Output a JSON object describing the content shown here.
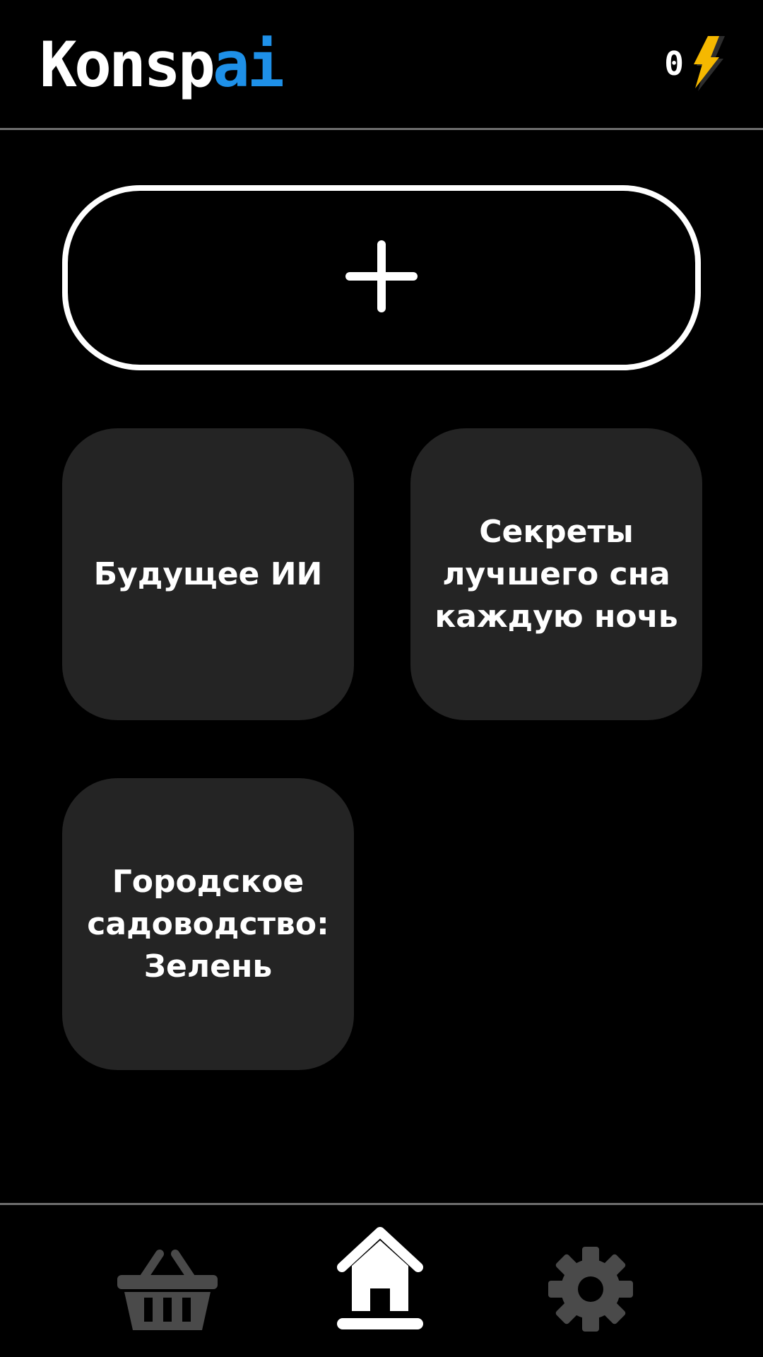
{
  "header": {
    "logo_main": "Konsp",
    "logo_accent": "ai",
    "energy_count": "0",
    "energy_icon": "lightning-icon"
  },
  "create": {
    "icon": "plus-icon"
  },
  "cards": [
    {
      "label": "Будущее ИИ"
    },
    {
      "label": "Секреты\nлучшего сна\nкаждую ночь"
    },
    {
      "label": "Городское\nсадоводство:\nЗелень"
    }
  ],
  "nav": {
    "items": [
      {
        "icon": "basket-icon",
        "active": false
      },
      {
        "icon": "home-icon",
        "active": true
      },
      {
        "icon": "gear-icon",
        "active": false
      }
    ]
  },
  "colors": {
    "background": "#000000",
    "card": "#242424",
    "accent": "#1e90e8",
    "energy": "#f5b800",
    "inactive_icon": "#4a4a4a",
    "divider": "#6e6e6e"
  }
}
